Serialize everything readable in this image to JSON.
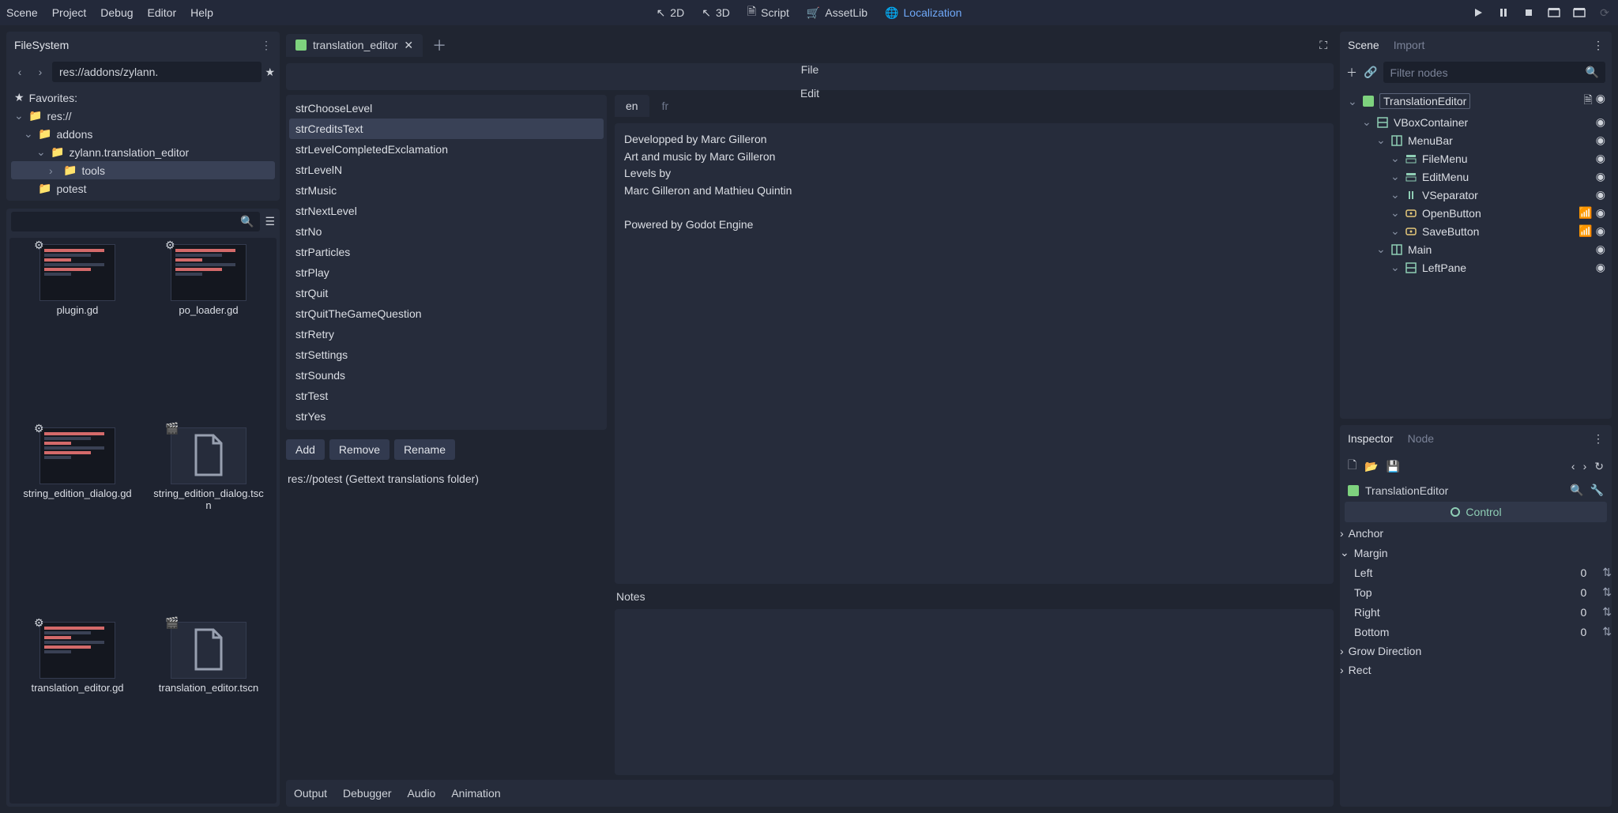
{
  "menu": [
    "Scene",
    "Project",
    "Debug",
    "Editor",
    "Help"
  ],
  "center_tools": [
    {
      "icon": "cursor-2d",
      "label": "2D"
    },
    {
      "icon": "cursor-3d",
      "label": "3D"
    },
    {
      "icon": "script",
      "label": "Script"
    },
    {
      "icon": "assetlib",
      "label": "AssetLib"
    },
    {
      "icon": "localization",
      "label": "Localization",
      "active": true
    }
  ],
  "filesystem": {
    "title": "FileSystem",
    "path": "res://addons/zylann.",
    "favorites_label": "Favorites:",
    "tree": [
      {
        "label": "res://",
        "depth": 0,
        "expanded": true,
        "icon": "folder"
      },
      {
        "label": "addons",
        "depth": 1,
        "expanded": true,
        "icon": "folder"
      },
      {
        "label": "zylann.translation_editor",
        "depth": 2,
        "expanded": true,
        "icon": "folder"
      },
      {
        "label": "tools",
        "depth": 3,
        "expanded": false,
        "icon": "folder",
        "selected": true
      },
      {
        "label": "potest",
        "depth": 1,
        "expanded": false,
        "icon": "folder"
      }
    ],
    "files": [
      {
        "name": "plugin.gd",
        "kind": "code"
      },
      {
        "name": "po_loader.gd",
        "kind": "code"
      },
      {
        "name": "string_edition_dialog.gd",
        "kind": "code"
      },
      {
        "name": "string_edition_dialog.tscn",
        "kind": "scene"
      },
      {
        "name": "translation_editor.gd",
        "kind": "code"
      },
      {
        "name": "translation_editor.tscn",
        "kind": "scene"
      }
    ]
  },
  "editor_tab": {
    "name": "translation_editor"
  },
  "editor_menu": [
    "File",
    "Edit"
  ],
  "string_keys": [
    "strChooseLevel",
    "strCreditsText",
    "strLevelCompletedExclamation",
    "strLevelN",
    "strMusic",
    "strNextLevel",
    "strNo",
    "strParticles",
    "strPlay",
    "strQuit",
    "strQuitTheGameQuestion",
    "strRetry",
    "strSettings",
    "strSounds",
    "strTest",
    "strYes"
  ],
  "selected_key": "strCreditsText",
  "str_buttons": {
    "add": "Add",
    "remove": "Remove",
    "rename": "Rename"
  },
  "status": "res://potest (Gettext translations folder)",
  "lang_tabs": [
    "en",
    "fr"
  ],
  "active_lang": "en",
  "translation_text": "Developped by Marc Gilleron\nArt and music by Marc Gilleron\nLevels by\nMarc Gilleron and Mathieu Quintin\n\nPowered by Godot Engine",
  "notes_label": "Notes",
  "bottom_tabs": [
    "Output",
    "Debugger",
    "Audio",
    "Animation"
  ],
  "scene_panel": {
    "tabs": [
      "Scene",
      "Import"
    ],
    "filter_placeholder": "Filter nodes",
    "tree": [
      {
        "label": "TranslationEditor",
        "depth": 0,
        "icon": "control-green",
        "root": true,
        "extras": [
          "script",
          "eye"
        ]
      },
      {
        "label": "VBoxContainer",
        "depth": 1,
        "icon": "vbox",
        "extras": [
          "eye"
        ]
      },
      {
        "label": "MenuBar",
        "depth": 2,
        "icon": "hbox",
        "extras": [
          "eye"
        ]
      },
      {
        "label": "FileMenu",
        "depth": 3,
        "icon": "menu",
        "extras": [
          "eye"
        ]
      },
      {
        "label": "EditMenu",
        "depth": 3,
        "icon": "menu",
        "extras": [
          "eye"
        ]
      },
      {
        "label": "VSeparator",
        "depth": 3,
        "icon": "vsep",
        "extras": [
          "eye"
        ]
      },
      {
        "label": "OpenButton",
        "depth": 3,
        "icon": "button",
        "extras": [
          "signal",
          "eye"
        ]
      },
      {
        "label": "SaveButton",
        "depth": 3,
        "icon": "button",
        "extras": [
          "signal",
          "eye"
        ]
      },
      {
        "label": "Main",
        "depth": 2,
        "icon": "hbox",
        "extras": [
          "eye"
        ]
      },
      {
        "label": "LeftPane",
        "depth": 3,
        "icon": "vbox",
        "extras": [
          "eye"
        ]
      }
    ]
  },
  "inspector": {
    "tabs": [
      "Inspector",
      "Node"
    ],
    "obj_name": "TranslationEditor",
    "section": "Control",
    "groups": [
      {
        "label": "Anchor",
        "expanded": false
      },
      {
        "label": "Margin",
        "expanded": true,
        "props": [
          {
            "label": "Left",
            "value": "0"
          },
          {
            "label": "Top",
            "value": "0"
          },
          {
            "label": "Right",
            "value": "0"
          },
          {
            "label": "Bottom",
            "value": "0"
          }
        ]
      },
      {
        "label": "Grow Direction",
        "expanded": false
      },
      {
        "label": "Rect",
        "expanded": false
      }
    ]
  }
}
